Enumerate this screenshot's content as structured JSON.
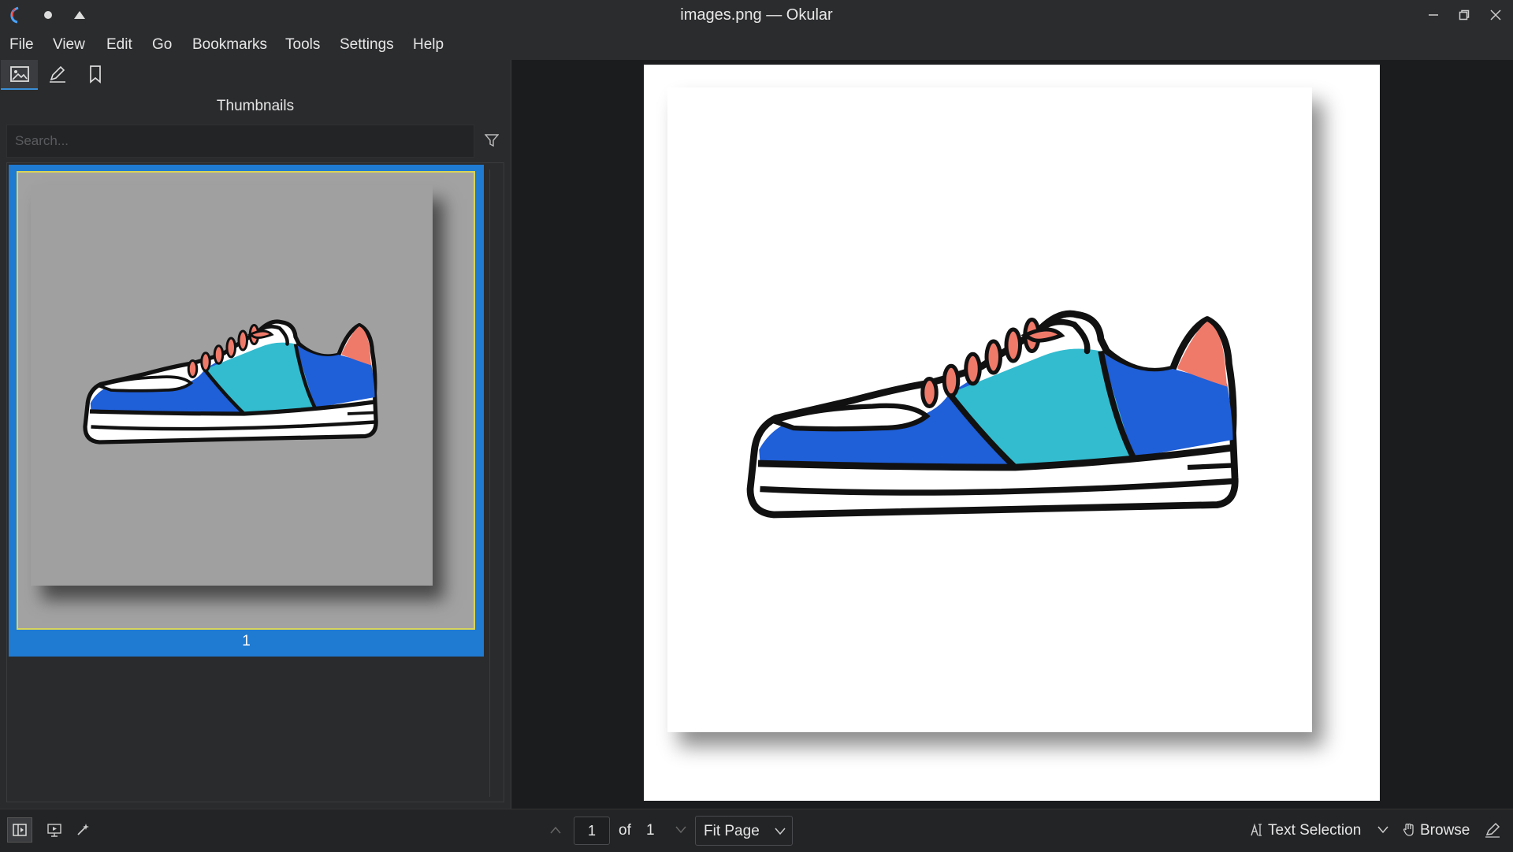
{
  "window": {
    "title": "images.png — Okular"
  },
  "menu": [
    "File",
    "View",
    "Edit",
    "Go",
    "Bookmarks",
    "Tools",
    "Settings",
    "Help"
  ],
  "sidebar": {
    "panel_title": "Thumbnails",
    "search_placeholder": "Search...",
    "thumbnails": [
      {
        "label": "1",
        "selected": true
      }
    ]
  },
  "statusbar": {
    "current_page": "1",
    "of_label": "of",
    "total_pages": "1",
    "zoom": "Fit Page",
    "text_selection": "Text Selection",
    "browse": "Browse"
  },
  "colors": {
    "accent": "#1f7ad1",
    "thumb_highlight": "#d8d45a",
    "shoe_blue": "#1f5fd8",
    "shoe_teal": "#33bcd0",
    "shoe_salmon": "#f07a6a"
  },
  "icons": [
    "okular-app-icon",
    "pin-icon",
    "keep-above-icon",
    "thumbnails-tab-icon",
    "annotations-tab-icon",
    "bookmarks-tab-icon",
    "filter-icon",
    "sidebar-toggle-icon",
    "presentation-icon",
    "magic-icon",
    "prev-page-icon",
    "next-page-icon",
    "text-select-icon",
    "browse-hand-icon",
    "annotate-icon",
    "minimize-icon",
    "maximize-icon",
    "close-icon"
  ]
}
